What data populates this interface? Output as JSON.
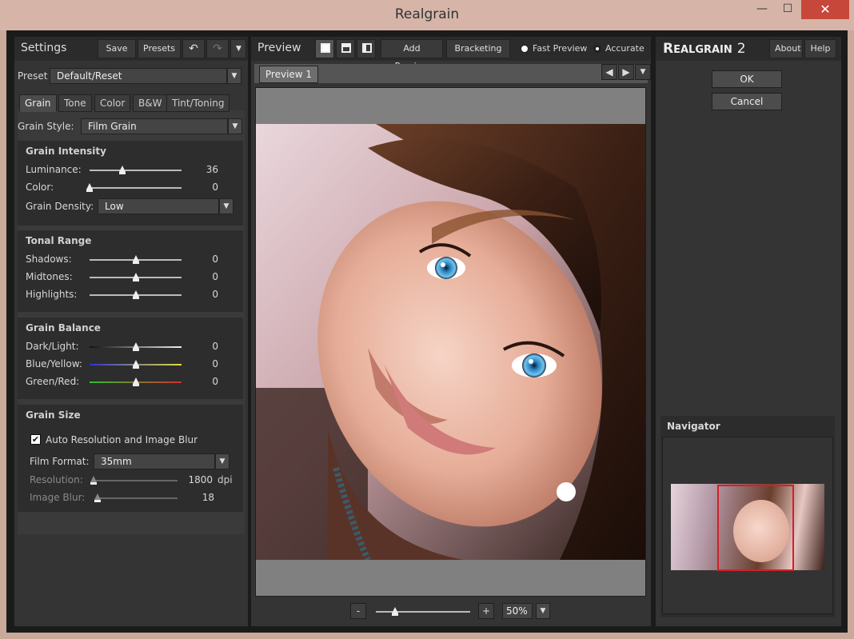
{
  "window": {
    "title": "Realgrain",
    "min": "—",
    "max": "☐",
    "close": "✕"
  },
  "settings": {
    "title": "Settings",
    "save": "Save",
    "presets": "Presets",
    "undo": "↶",
    "redo": "↷",
    "more": "▼",
    "preset_label": "Preset",
    "preset_value": "Default/Reset",
    "tabs": [
      "Grain",
      "Tone",
      "Color",
      "B&W",
      "Tint/Toning"
    ],
    "grain_style_label": "Grain Style:",
    "grain_style_value": "Film Grain",
    "grain_intensity": {
      "title": "Grain Intensity",
      "luminance_label": "Luminance:",
      "luminance_value": "36",
      "luminance_level": 0.36,
      "color_label": "Color:",
      "color_value": "0",
      "color_level": 0.0,
      "density_label": "Grain Density:",
      "density_value": "Low"
    },
    "tonal_range": {
      "title": "Tonal Range",
      "rows": [
        {
          "label": "Shadows:",
          "value": "0",
          "level": 0.5
        },
        {
          "label": "Midtones:",
          "value": "0",
          "level": 0.5
        },
        {
          "label": "Highlights:",
          "value": "0",
          "level": 0.5
        }
      ]
    },
    "grain_balance": {
      "title": "Grain Balance",
      "rows": [
        {
          "label": "Dark/Light:",
          "value": "0",
          "level": 0.5
        },
        {
          "label": "Blue/Yellow:",
          "value": "0",
          "level": 0.5
        },
        {
          "label": "Green/Red:",
          "value": "0",
          "level": 0.5
        }
      ]
    },
    "grain_size": {
      "title": "Grain Size",
      "auto_label": "Auto Resolution and Image Blur",
      "auto_checked": true,
      "film_format_label": "Film Format:",
      "film_format_value": "35mm",
      "resolution_label": "Resolution:",
      "resolution_value": "1800",
      "resolution_unit": "dpi",
      "resolution_level": 0.0,
      "blur_label": "Image Blur:",
      "blur_value": "18",
      "blur_level": 0.0
    }
  },
  "preview": {
    "title": "Preview",
    "add_preview": "Add Preview",
    "bracketing": "Bracketing",
    "fast_preview": "Fast Preview",
    "accurate": "Accurate",
    "tab": "Preview 1",
    "zoom_minus": "-",
    "zoom_plus": "+",
    "zoom_value": "50%",
    "zoom_level": 0.2
  },
  "right": {
    "brand_big": "R",
    "brand_small": "EALGRAIN",
    "brand_num": "2",
    "about": "About",
    "help": "Help",
    "ok": "OK",
    "cancel": "Cancel",
    "navigator": "Navigator"
  },
  "colors": {
    "accent_red": "#d0202a",
    "panel": "#343434"
  }
}
